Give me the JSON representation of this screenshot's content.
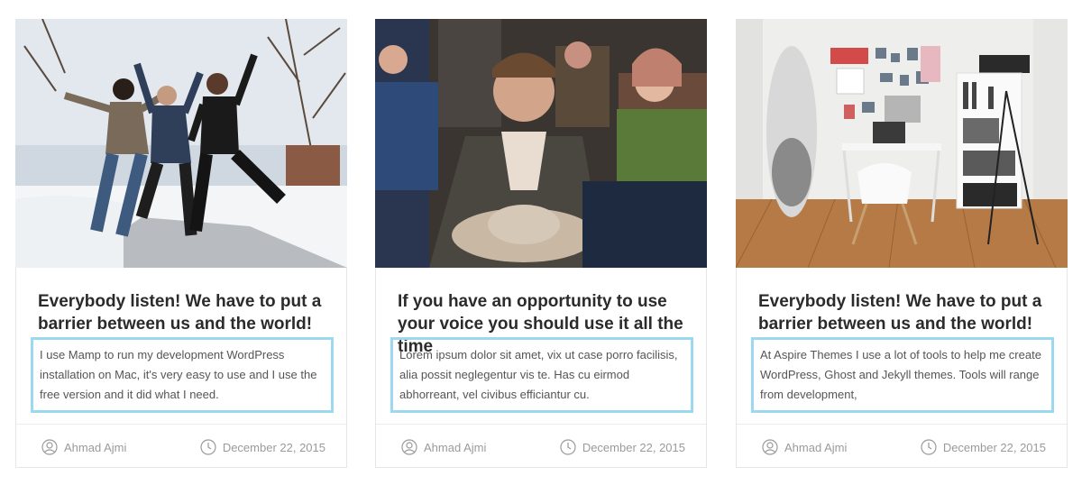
{
  "posts": [
    {
      "title": "Everybody listen! We have to put a barrier between us and the world!",
      "excerpt": "I use Mamp to run my development WordPress installation on Mac, it's very easy to use and I use the free version and it did what I need.",
      "author": "Ahmad Ajmi",
      "date": "December 22, 2015",
      "image": "friends-jumping-in-snow"
    },
    {
      "title": "If you have an opportunity to use your voice you should use it all the time",
      "excerpt": "Lorem ipsum dolor sit amet, vix ut case porro facilisis, alia possit neglegentur vis te. Has cu eirmod abhorreant, vel civibus efficiantur cu.",
      "author": "Ahmad Ajmi",
      "date": "December 22, 2015",
      "image": "man-in-crowd-with-hat"
    },
    {
      "title": "Everybody listen! We have to put a barrier between us and the world!",
      "excerpt": "At Aspire Themes I use a lot of tools to help me create WordPress, Ghost and Jekyll themes. Tools will range from development,",
      "author": "Ahmad Ajmi",
      "date": "December 22, 2015",
      "image": "room-with-desk-and-surfboard"
    }
  ],
  "icons": {
    "author": "user-circle-icon",
    "date": "clock-icon"
  },
  "colors": {
    "highlight": "#9ad9f0",
    "meta": "#9a9a9a",
    "title": "#2b2b2b"
  }
}
